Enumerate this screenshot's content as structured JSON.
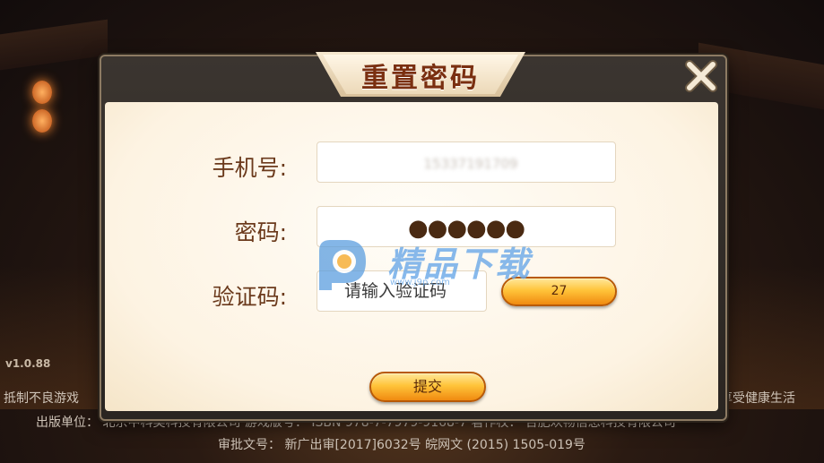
{
  "version": "v1.0.88",
  "dialog": {
    "title": "重置密码",
    "close_icon": "close-icon",
    "phone_label": "手机号:",
    "phone_value": "15337191709",
    "password_label": "密码:",
    "password_mask": "●●●●●●",
    "code_label": "验证码:",
    "code_placeholder": "请输入验证码",
    "countdown": "27",
    "submit_label": "提交"
  },
  "watermark": {
    "text": "精品下载",
    "url": "www.j9p.com"
  },
  "footer": {
    "line1_left": "抵制不良游戏",
    "line1_right": "享受健康生活",
    "line2": "出版单位：  北京中科奥科技有限公司  游戏版号：  ISBN 978-7-7979-9168-7  著作权：  合肥欢畅信息科技有限公司",
    "line3": "审批文号：  新广出审[2017]6032号 皖网文 (2015) 1505-019号"
  },
  "colors": {
    "accent": "#f0a020",
    "label": "#6b3a1c",
    "title": "#7a2f10"
  }
}
